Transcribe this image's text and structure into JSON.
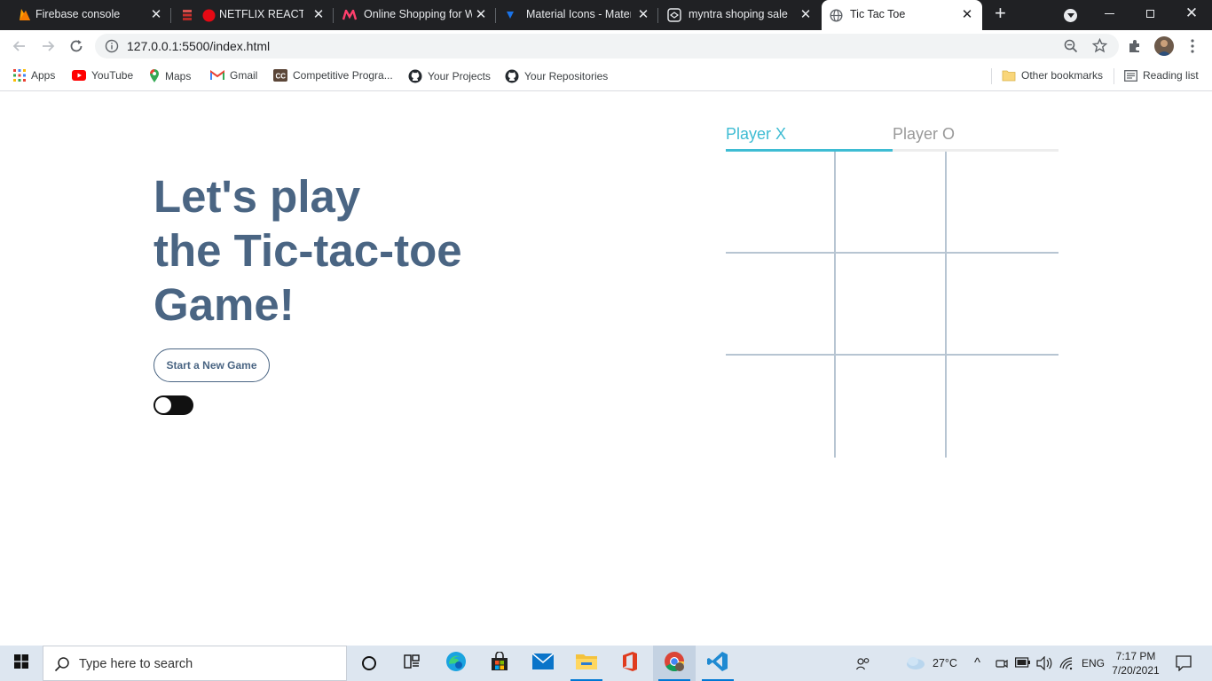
{
  "browser": {
    "tabs": [
      {
        "title": "Firebase console",
        "favicon": "firebase-icon"
      },
      {
        "title": "NETFLIX REACT.JS",
        "favicon": "record-icon"
      },
      {
        "title": "Online Shopping for W",
        "favicon": "myntra-icon"
      },
      {
        "title": "Material Icons - Mater",
        "favicon": "material-icon"
      },
      {
        "title": "myntra shoping sale",
        "favicon": "codepen-icon"
      },
      {
        "title": "Tic Tac Toe",
        "favicon": "globe-icon"
      }
    ],
    "new_tab_label": "+",
    "url": "127.0.0.1:5500/index.html",
    "bookmarks": [
      {
        "label": "Apps",
        "icon": "apps-grid-icon"
      },
      {
        "label": "YouTube",
        "icon": "youtube-icon"
      },
      {
        "label": "Maps",
        "icon": "maps-pin-icon"
      },
      {
        "label": "Gmail",
        "icon": "gmail-icon"
      },
      {
        "label": "Competitive Progra...",
        "icon": "codechef-icon"
      },
      {
        "label": "Your Projects",
        "icon": "github-icon"
      },
      {
        "label": "Your Repositories",
        "icon": "github-icon"
      }
    ],
    "other_bookmarks": "Other bookmarks",
    "reading_list": "Reading list"
  },
  "game": {
    "heading_line1": "Let's play",
    "heading_line2": "the Tic-tac-toe",
    "heading_line3": "Game!",
    "new_game_label": "Start a New Game",
    "dark_mode_toggle": {
      "on": true
    },
    "player_x_label": "Player X",
    "player_o_label": "Player O",
    "active_player": "X",
    "board": [
      "",
      "",
      "",
      "",
      "",
      "",
      "",
      "",
      ""
    ],
    "colors": {
      "heading": "#4a6583",
      "accent": "#3ebcd3",
      "grid": "#b7c5d2"
    }
  },
  "taskbar": {
    "search_placeholder": "Type here to search",
    "weather": "27°C",
    "language": "ENG",
    "time": "7:17 PM",
    "date": "7/20/2021"
  }
}
